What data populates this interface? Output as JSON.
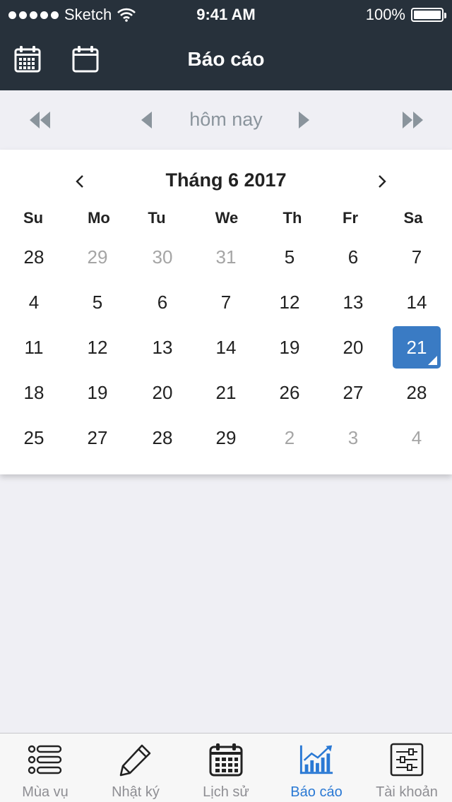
{
  "status_bar": {
    "carrier": "Sketch",
    "time": "9:41 AM",
    "battery": "100%"
  },
  "header": {
    "title": "Báo cáo",
    "icons": [
      "calendar-month-icon",
      "calendar-day-icon"
    ]
  },
  "date_nav": {
    "label": "hôm nay"
  },
  "calendar": {
    "month_label": "Tháng 6 2017",
    "weekdays": [
      "Su",
      "Mo",
      "Tu",
      "We",
      "Th",
      "Fr",
      "Sa"
    ],
    "weeks": [
      [
        "28",
        "29",
        "30",
        "31",
        "5",
        "6",
        "7"
      ],
      [
        "4",
        "5",
        "6",
        "7",
        "12",
        "13",
        "14"
      ],
      [
        "11",
        "12",
        "13",
        "14",
        "19",
        "20",
        "21"
      ],
      [
        "18",
        "19",
        "20",
        "21",
        "26",
        "27",
        "28"
      ],
      [
        "25",
        "27",
        "28",
        "29",
        "2",
        "3",
        "4"
      ]
    ],
    "dimmed": [
      [
        0,
        1
      ],
      [
        0,
        2
      ],
      [
        0,
        3
      ],
      [
        4,
        4
      ],
      [
        4,
        5
      ],
      [
        4,
        6
      ]
    ],
    "selected": [
      2,
      6
    ],
    "selected_color": "#3a7bc4"
  },
  "tabs": [
    {
      "label": "Mùa vụ",
      "icon": "list-icon"
    },
    {
      "label": "Nhật ký",
      "icon": "pencil-icon"
    },
    {
      "label": "Lịch sử",
      "icon": "calendar-icon"
    },
    {
      "label": "Báo cáo",
      "icon": "chart-icon",
      "active": true
    },
    {
      "label": "Tài khoản",
      "icon": "settings-sliders-icon"
    }
  ],
  "colors": {
    "header_bg": "#27313b",
    "active_tab": "#2a79d4",
    "inactive_tab": "#8e8e93"
  }
}
